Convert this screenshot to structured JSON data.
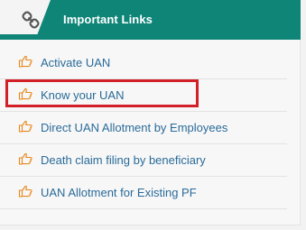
{
  "panel": {
    "title": "Important Links",
    "header_icon": "link-icon",
    "accent_color": "#0f8578",
    "link_color": "#2a6b99",
    "bullet_icon": "pointing-hand-icon",
    "bullet_color": "#e8871a",
    "highlight_color": "#d32028"
  },
  "links": [
    {
      "label": "Activate UAN"
    },
    {
      "label": "Know your UAN",
      "highlighted": true
    },
    {
      "label": "Direct UAN Allotment by Employees"
    },
    {
      "label": "Death claim filing by beneficiary"
    },
    {
      "label": "UAN Allotment for Existing PF"
    }
  ]
}
